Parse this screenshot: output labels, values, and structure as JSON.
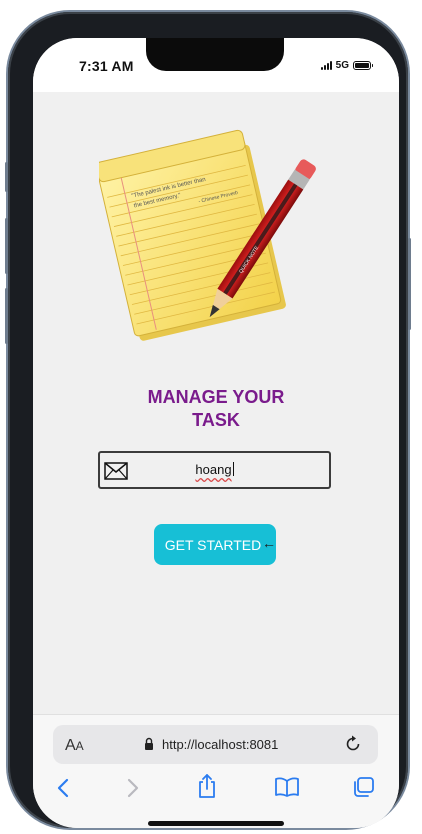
{
  "status_bar": {
    "time": "7:31 AM",
    "network": "5G"
  },
  "main": {
    "title_line1": "MANAGE YOUR",
    "title_line2": "TASK",
    "input": {
      "value": "hoang",
      "icon": "envelope-icon"
    },
    "start_button_label": "GET STARTED",
    "illustration": {
      "quote": "\"The palest ink is better than the best memory.\"",
      "quote_attribution": "- Chinese Proverb",
      "pencil_text": "QUICK NOTE"
    }
  },
  "safari": {
    "aa_label_big": "A",
    "aa_label_small": "A",
    "url": "http://localhost:8081",
    "toolbar_icons": [
      "back-icon",
      "forward-icon",
      "share-icon",
      "bookmarks-icon",
      "tabs-icon"
    ]
  },
  "colors": {
    "title": "#7a1b8c",
    "button": "#17bfd6",
    "accent_blue": "#2b7cf0",
    "background": "#f0f0f0"
  }
}
